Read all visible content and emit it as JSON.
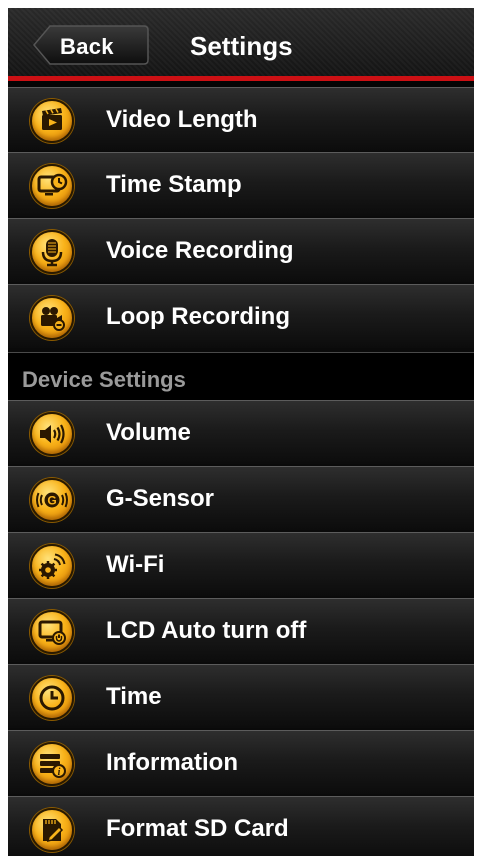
{
  "header": {
    "back_label": "Back",
    "title": "Settings"
  },
  "rows_top": [
    {
      "label": "Video Length",
      "icon": "video-clip-icon"
    },
    {
      "label": "Time Stamp",
      "icon": "monitor-clock-icon"
    },
    {
      "label": "Voice Recording",
      "icon": "microphone-icon"
    },
    {
      "label": "Loop Recording",
      "icon": "camera-loop-icon"
    }
  ],
  "section": {
    "label": "Device Settings"
  },
  "rows_device": [
    {
      "label": "Volume",
      "icon": "speaker-icon"
    },
    {
      "label": "G-Sensor",
      "icon": "g-sensor-icon"
    },
    {
      "label": "Wi-Fi",
      "icon": "wifi-gear-icon"
    },
    {
      "label": "LCD Auto turn off",
      "icon": "monitor-power-icon"
    },
    {
      "label": "Time",
      "icon": "clock-icon"
    },
    {
      "label": "Information",
      "icon": "info-card-icon"
    },
    {
      "label": "Format SD Card",
      "icon": "sd-card-icon"
    }
  ],
  "colors": {
    "accent_red": "#cc1014",
    "icon_orange": "#f9b31a",
    "section_text": "#9a9a9a"
  }
}
